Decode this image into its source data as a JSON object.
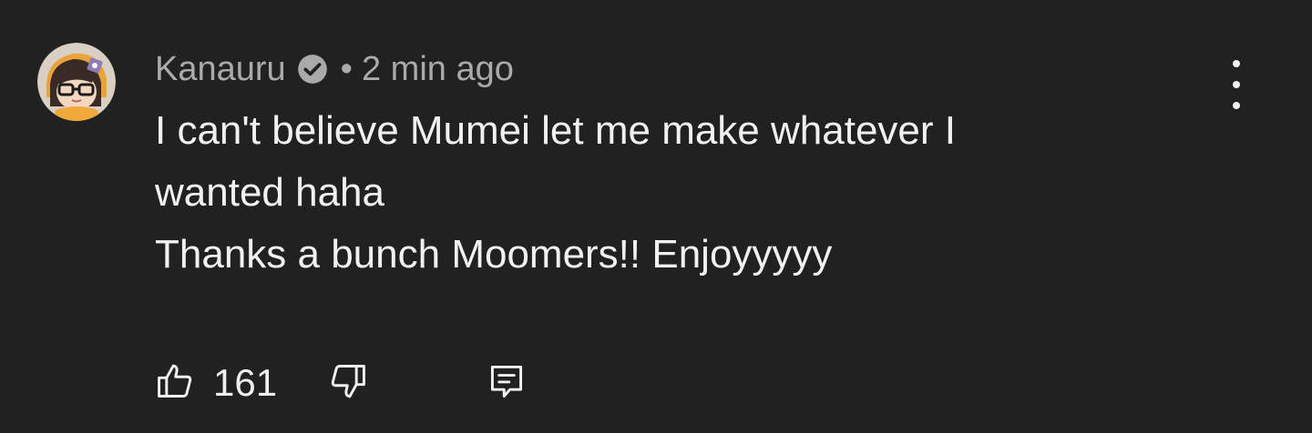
{
  "comment": {
    "author": "Kanauru",
    "separator": "•",
    "timestamp": "2 min ago",
    "text_lines": [
      "I can't believe Mumei let me make whatever I",
      "wanted haha",
      "Thanks a bunch Moomers!! Enjoyyyyy"
    ],
    "like_count": "161"
  },
  "icons": {
    "avatar": "avatar-image",
    "verified": "verified-check-icon",
    "menu": "more-vertical-icon",
    "like": "thumbs-up-icon",
    "dislike": "thumbs-down-icon",
    "reply": "reply-comment-icon"
  },
  "colors": {
    "background": "#212121",
    "primary_text": "#f1f1f1",
    "secondary_text": "#aaaaaa"
  }
}
